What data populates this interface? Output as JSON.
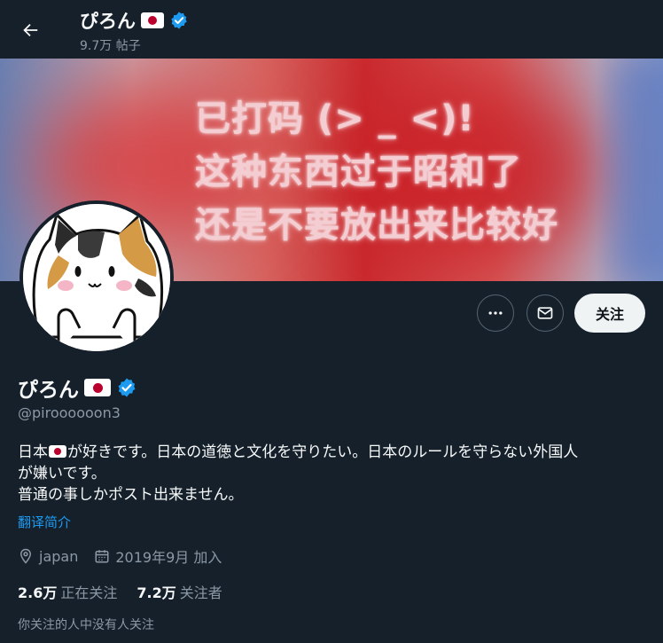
{
  "header": {
    "display_name": "ぴろん",
    "post_count": "9.7万 帖子"
  },
  "banner": {
    "lines": [
      "已打码 (> _ <)!",
      "这种东西过于昭和了",
      "还是不要放出来比较好"
    ]
  },
  "actions": {
    "follow_label": "关注"
  },
  "profile": {
    "display_name": "ぴろん",
    "handle": "@piroooooon3",
    "bio_line1_a": "日本",
    "bio_line1_b": "が好きです。日本の道徳と文化を守りたい。日本のルールを守らない外国人",
    "bio_line2": "が嫌いです。",
    "bio_line3": "普通の事しかポスト出来ません。",
    "translate_label": "翻译简介",
    "location": "japan",
    "joined": "2019年9月 加入",
    "following_count": "2.6万",
    "following_label": "正在关注",
    "followers_count": "7.2万",
    "followers_label": "关注者",
    "followed_by_note": "你关注的人中没有人关注"
  },
  "colors": {
    "background": "#15202b",
    "accent": "#1d9bf0",
    "secondary_text": "#8b98a5"
  }
}
